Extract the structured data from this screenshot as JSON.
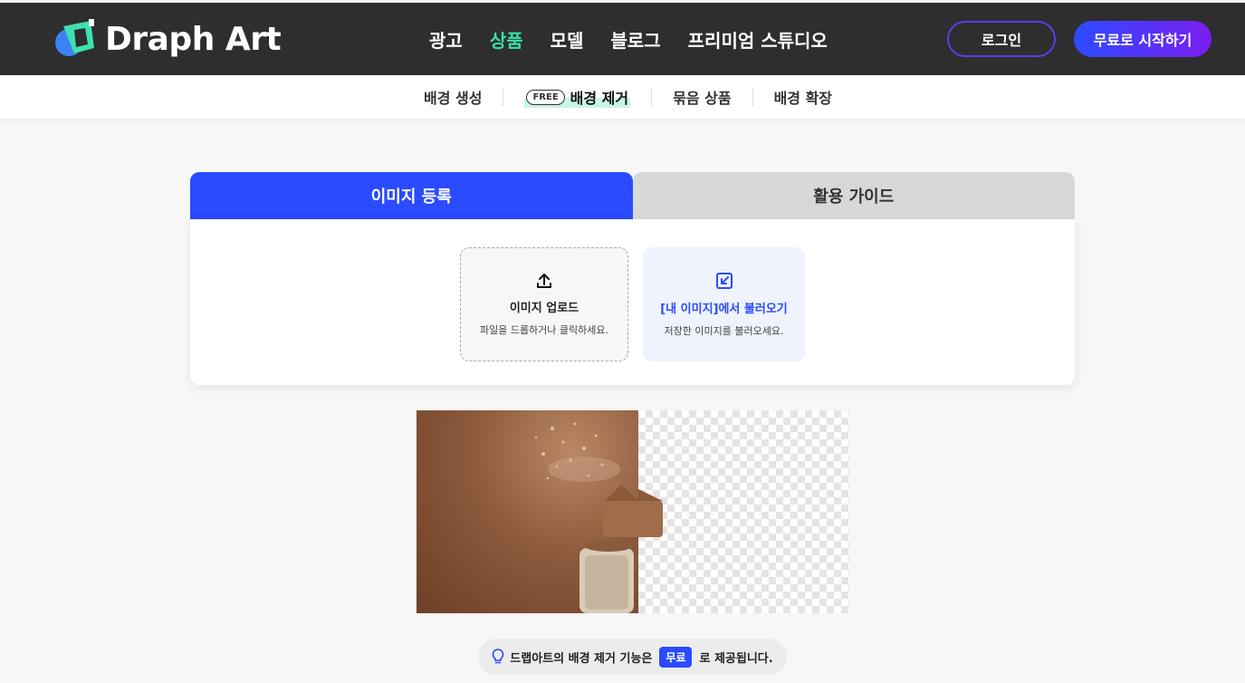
{
  "header": {
    "logo_text": "Draph Art",
    "nav": [
      "광고",
      "상품",
      "모델",
      "블로그",
      "프리미엄 스튜디오"
    ],
    "active_nav": "상품",
    "login_label": "로그인",
    "start_label": "무료로 시작하기"
  },
  "subnav": {
    "items": [
      {
        "label": "배경 생성"
      },
      {
        "label": "배경 제거",
        "badge": "FREE"
      },
      {
        "label": "묶음 상품"
      },
      {
        "label": "배경 확장"
      }
    ]
  },
  "tabs": {
    "register": "이미지 등록",
    "guide": "활용 가이드"
  },
  "upload": {
    "title": "이미지 업로드",
    "subtitle": "파일을 드롭하거나 클릭하세요."
  },
  "load": {
    "title": "[내 이미지]에서 불러오기",
    "subtitle": "저장한 이미지를 불러오세요."
  },
  "info": {
    "before": "드랩아트의 배경 제거 기능은",
    "badge": "무료",
    "after": "로 제공됩니다."
  },
  "colors": {
    "brand_blue": "#2a4bff",
    "accent_green": "#38e0a8",
    "header_bg": "#2e2e2e"
  },
  "icons": {
    "upload": "upload-icon",
    "load": "import-icon",
    "info": "lightbulb-icon"
  }
}
